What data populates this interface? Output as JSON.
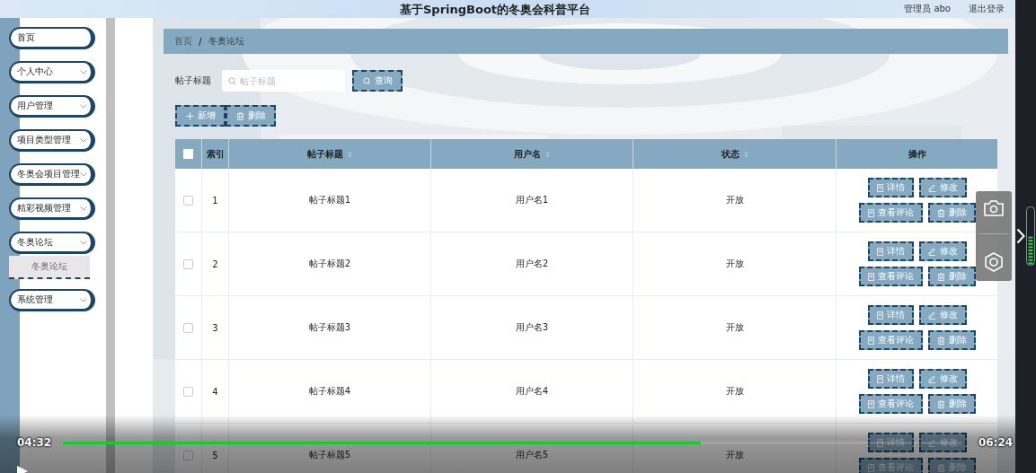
{
  "header": {
    "title": "基于SpringBoot的冬奥会科普平台",
    "user": "管理员 abo",
    "logout": "退出登录"
  },
  "sidebar": {
    "items": [
      {
        "label": "首页",
        "has_arrow": false
      },
      {
        "label": "个人中心",
        "has_arrow": true
      },
      {
        "label": "用户管理",
        "has_arrow": true
      },
      {
        "label": "项目类型管理",
        "has_arrow": true
      },
      {
        "label": "冬奥会项目管理",
        "has_arrow": true
      },
      {
        "label": "精彩视频管理",
        "has_arrow": true
      },
      {
        "label": "冬奥论坛",
        "has_arrow": true,
        "children": [
          {
            "label": "冬奥论坛"
          }
        ]
      },
      {
        "label": "系统管理",
        "has_arrow": true
      }
    ]
  },
  "breadcrumb": {
    "items": [
      "首页",
      "冬奥论坛"
    ],
    "separator": "/"
  },
  "search": {
    "label": "帖子标题",
    "placeholder": "帖子标题",
    "button": "查询"
  },
  "actions": [
    {
      "kind": "add",
      "label": "新增"
    },
    {
      "kind": "delete",
      "label": "删除"
    }
  ],
  "table": {
    "header_checked": false,
    "columns": [
      {
        "label": "索引",
        "sortable": false
      },
      {
        "label": "帖子标题",
        "sortable": true
      },
      {
        "label": "用户名",
        "sortable": true
      },
      {
        "label": "状态",
        "sortable": true
      },
      {
        "label": "操作",
        "sortable": false
      }
    ],
    "rows": [
      {
        "checked": false,
        "cells": [
          "1",
          "帖子标题1",
          "用户名1",
          "开放"
        ],
        "actions": [
          {
            "kind": "detail",
            "label": "详情"
          },
          {
            "kind": "edit",
            "label": "修改"
          },
          {
            "kind": "comments",
            "label": "查看评论"
          },
          {
            "kind": "delete",
            "label": "删除"
          }
        ]
      },
      {
        "checked": false,
        "cells": [
          "2",
          "帖子标题2",
          "用户名2",
          "开放"
        ],
        "actions": [
          {
            "kind": "detail",
            "label": "详情"
          },
          {
            "kind": "edit",
            "label": "修改"
          },
          {
            "kind": "comments",
            "label": "查看评论"
          },
          {
            "kind": "delete",
            "label": "删除"
          }
        ]
      },
      {
        "checked": false,
        "cells": [
          "3",
          "帖子标题3",
          "用户名3",
          "开放"
        ],
        "actions": [
          {
            "kind": "detail",
            "label": "详情"
          },
          {
            "kind": "edit",
            "label": "修改"
          },
          {
            "kind": "comments",
            "label": "查看评论"
          },
          {
            "kind": "delete",
            "label": "删除"
          }
        ]
      },
      {
        "checked": false,
        "cells": [
          "4",
          "帖子标题4",
          "用户名4",
          "开放"
        ],
        "actions": [
          {
            "kind": "detail",
            "label": "详情"
          },
          {
            "kind": "edit",
            "label": "修改"
          },
          {
            "kind": "comments",
            "label": "查看评论"
          },
          {
            "kind": "delete",
            "label": "删除"
          }
        ]
      },
      {
        "checked": false,
        "cells": [
          "5",
          "帖子标题5",
          "用户名5",
          "开放"
        ],
        "actions": [
          {
            "kind": "detail",
            "label": "详情"
          },
          {
            "kind": "edit",
            "label": "修改"
          },
          {
            "kind": "comments",
            "label": "查看评论"
          },
          {
            "kind": "delete",
            "label": "删除"
          }
        ]
      }
    ]
  },
  "player": {
    "elapsed": "04:32",
    "duration": "06:24",
    "level": 0.71
  }
}
